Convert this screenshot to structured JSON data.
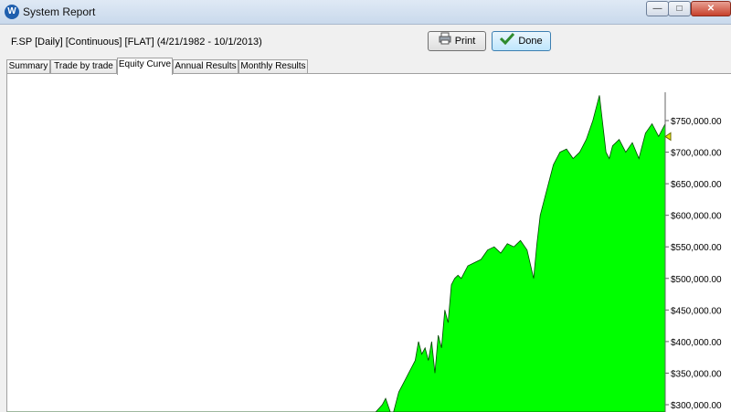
{
  "window": {
    "title": "System Report",
    "app_icon": "W",
    "controls": {
      "minimize": "minimize-icon",
      "maximize": "maximize-icon",
      "close": "close-icon"
    }
  },
  "header": {
    "series_info": "F.SP [Daily] [Continuous] [FLAT]  (4/21/1982 - 10/1/2013)",
    "print_label": "Print",
    "done_label": "Done"
  },
  "tabs": [
    {
      "label": "Summary",
      "active": false
    },
    {
      "label": "Trade by trade",
      "active": false
    },
    {
      "label": "Equity Curve",
      "active": true
    },
    {
      "label": "Annual Results",
      "active": false
    },
    {
      "label": "Monthly Results",
      "active": false
    }
  ],
  "colors": {
    "fill": "#00ff00",
    "line": "#004400"
  },
  "chart_data": {
    "type": "area",
    "title": "",
    "xlabel": "",
    "ylabel": "",
    "ylim": [
      280000,
      810000
    ],
    "y_ticks": [
      "$750,000.00",
      "$700,000.00",
      "$650,000.00",
      "$600,000.00",
      "$550,000.00",
      "$500,000.00",
      "$450,000.00",
      "$400,000.00",
      "$350,000.00",
      "$300,000.00"
    ],
    "y_tick_values": [
      750000,
      700000,
      650000,
      600000,
      550000,
      500000,
      450000,
      400000,
      350000,
      300000
    ],
    "x": [
      0.0,
      0.56,
      0.57,
      0.575,
      0.58,
      0.585,
      0.59,
      0.595,
      0.6,
      0.605,
      0.61,
      0.615,
      0.62,
      0.625,
      0.63,
      0.635,
      0.64,
      0.645,
      0.65,
      0.655,
      0.66,
      0.665,
      0.67,
      0.675,
      0.68,
      0.685,
      0.69,
      0.695,
      0.7,
      0.71,
      0.72,
      0.73,
      0.74,
      0.75,
      0.76,
      0.77,
      0.78,
      0.79,
      0.8,
      0.805,
      0.81,
      0.815,
      0.82,
      0.83,
      0.84,
      0.85,
      0.86,
      0.87,
      0.88,
      0.89,
      0.9,
      0.91,
      0.915,
      0.92,
      0.93,
      0.94,
      0.95,
      0.96,
      0.97,
      0.98,
      0.99,
      1.0
    ],
    "values": [
      0,
      0,
      300000,
      310000,
      295000,
      280000,
      300000,
      320000,
      330000,
      340000,
      350000,
      360000,
      370000,
      400000,
      380000,
      390000,
      370000,
      400000,
      350000,
      410000,
      390000,
      450000,
      430000,
      490000,
      500000,
      505000,
      500000,
      510000,
      520000,
      525000,
      530000,
      545000,
      550000,
      540000,
      555000,
      550000,
      560000,
      545000,
      500000,
      555000,
      600000,
      620000,
      640000,
      680000,
      700000,
      705000,
      690000,
      700000,
      720000,
      750000,
      790000,
      700000,
      690000,
      710000,
      720000,
      700000,
      715000,
      690000,
      730000,
      745000,
      725000,
      745000
    ]
  }
}
